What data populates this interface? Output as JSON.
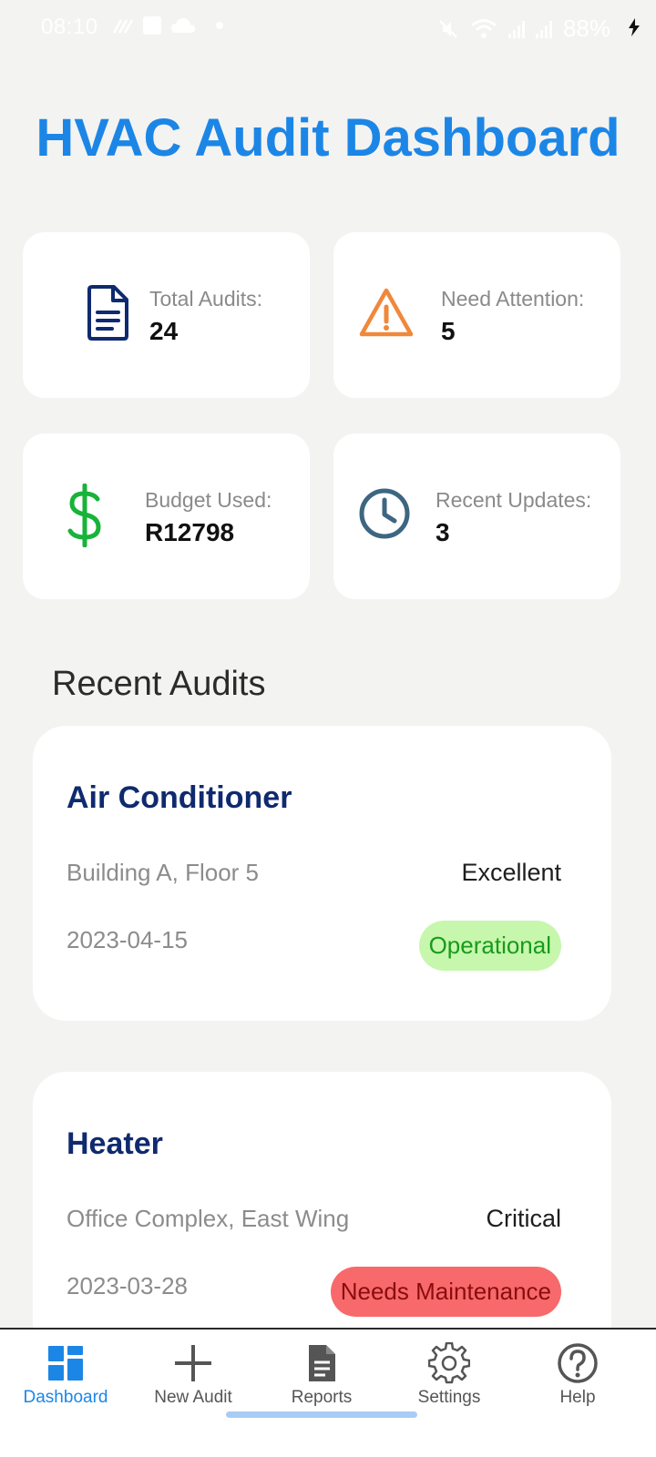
{
  "status_bar": {
    "time": "08:10",
    "battery": "88%",
    "icons": [
      "signal-icon",
      "facebook-icon",
      "cloud-icon",
      "dot-icon",
      "mute-icon",
      "wifi-icon",
      "cell-signal-icon",
      "cell-signal-icon",
      "battery-charging-icon"
    ]
  },
  "header": {
    "title": "HVAC Audit Dashboard"
  },
  "stats": [
    {
      "label": "Total Audits:",
      "value": "24",
      "icon": "document-icon",
      "color": "#0f2a6e"
    },
    {
      "label": "Need Attention:",
      "value": "5",
      "icon": "warning-icon",
      "color": "#f0883a"
    },
    {
      "label": "Budget Used:",
      "value": "R12798",
      "icon": "dollar-icon",
      "color": "#18b33a"
    },
    {
      "label": "Recent Updates:",
      "value": "3",
      "icon": "clock-icon",
      "color": "#3d6680"
    }
  ],
  "recent": {
    "title": "Recent Audits",
    "audits": [
      {
        "name": "Air Conditioner",
        "location": "Building A, Floor 5",
        "condition": "Excellent",
        "date": "2023-04-15",
        "status": "Operational",
        "status_bg": "#c6f7ad",
        "status_color": "#1a9a1a"
      },
      {
        "name": "Heater",
        "location": "Office Complex, East Wing",
        "condition": "Critical",
        "date": "2023-03-28",
        "status": "Needs Maintenance",
        "status_bg": "#f7696b",
        "status_color": "#8a0d0d"
      }
    ]
  },
  "bottom_nav": {
    "active": "Dashboard",
    "items": [
      {
        "label": "Dashboard",
        "icon": "dashboard-icon"
      },
      {
        "label": "New Audit",
        "icon": "plus-icon"
      },
      {
        "label": "Reports",
        "icon": "report-icon"
      },
      {
        "label": "Settings",
        "icon": "gear-icon"
      },
      {
        "label": "Help",
        "icon": "help-icon"
      }
    ]
  },
  "colors": {
    "accent": "#1c86e6",
    "background": "#f3f3f1",
    "card": "#ffffff",
    "title_dark": "#0f2a6e"
  }
}
